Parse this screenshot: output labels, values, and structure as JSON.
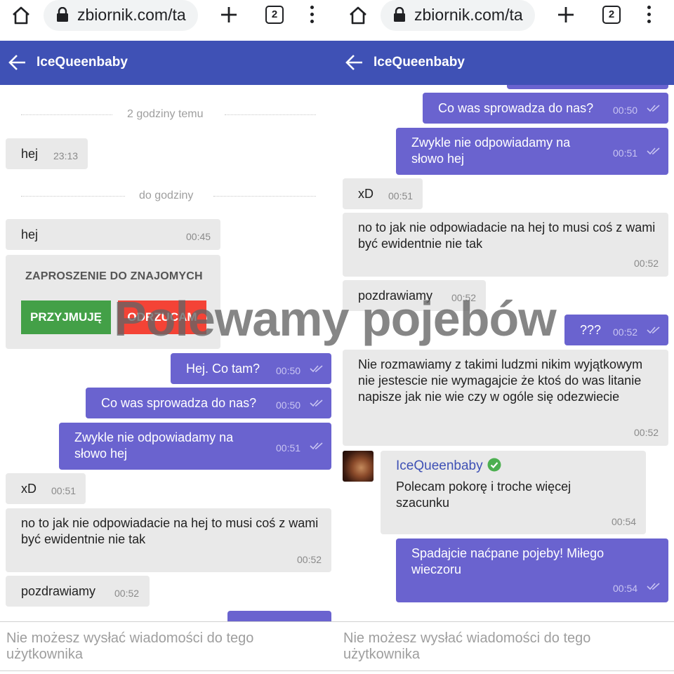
{
  "browser": {
    "url": "zbiornik.com/ta",
    "tab_count": "2",
    "icons": [
      "home-icon",
      "lock-icon",
      "new-tab-icon",
      "tab-switcher-icon",
      "kebab-menu-icon"
    ]
  },
  "app": {
    "contact_name": "IceQueenbaby",
    "header_color": "#3f51b5",
    "outgoing_bubble_color": "#6a63cf",
    "incoming_bubble_color": "#e9e9e9"
  },
  "left": {
    "dividers": [
      "2 godziny temu",
      "do godziny"
    ],
    "messages": [
      {
        "text": "hej",
        "time": "23:13"
      },
      {
        "text": "hej",
        "time": "00:45"
      },
      {
        "text": "Hej. Co tam?",
        "time": "00:50"
      },
      {
        "text": "Co was sprowadza do nas?",
        "time": "00:50"
      },
      {
        "text": "Zwykle nie odpowiadamy na słowo hej",
        "time": "00:51"
      },
      {
        "text": "xD",
        "time": "00:51"
      },
      {
        "text": "no to jak nie odpowiadacie na hej to musi coś z wami być ewidentnie nie tak",
        "time": "00:52"
      },
      {
        "text": "pozdrawiamy",
        "time": "00:52"
      }
    ],
    "invite": {
      "title": "ZAPROSZENIE DO ZNAJOMYCH",
      "accept": "PRZYJMUJĘ",
      "reject": "ODRZUCAM"
    }
  },
  "right": {
    "messages": [
      {
        "text": "Co was sprowadza do nas?",
        "time": "00:50"
      },
      {
        "text": "Zwykle nie odpowiadamy na słowo hej",
        "time": "00:51"
      },
      {
        "text": "xD",
        "time": "00:51"
      },
      {
        "text": "no to jak nie odpowiadacie na hej to musi coś z wami być ewidentnie nie tak",
        "time": "00:52"
      },
      {
        "text": "pozdrawiamy",
        "time": "00:52"
      },
      {
        "text": "???",
        "time": "00:52"
      },
      {
        "text": "Nie rozmawiamy z takimi ludzmi nikim wyjątkowym nie jestescie nie wymagajcie że ktoś do was litanie napisze jak nie wie czy w ogóle się odezwiecie",
        "time": "00:52"
      },
      {
        "sender": "IceQueenbaby",
        "text": "Polecam pokorę i troche więcej szacunku",
        "time": "00:54"
      },
      {
        "text": "Spadajcie naćpane pojeby! Miłego wieczoru",
        "time": "00:54"
      }
    ]
  },
  "compose": {
    "disabled_text": "Nie możesz wysłać wiadomości do tego użytkownika"
  },
  "watermark": "Polewamy pojebów"
}
